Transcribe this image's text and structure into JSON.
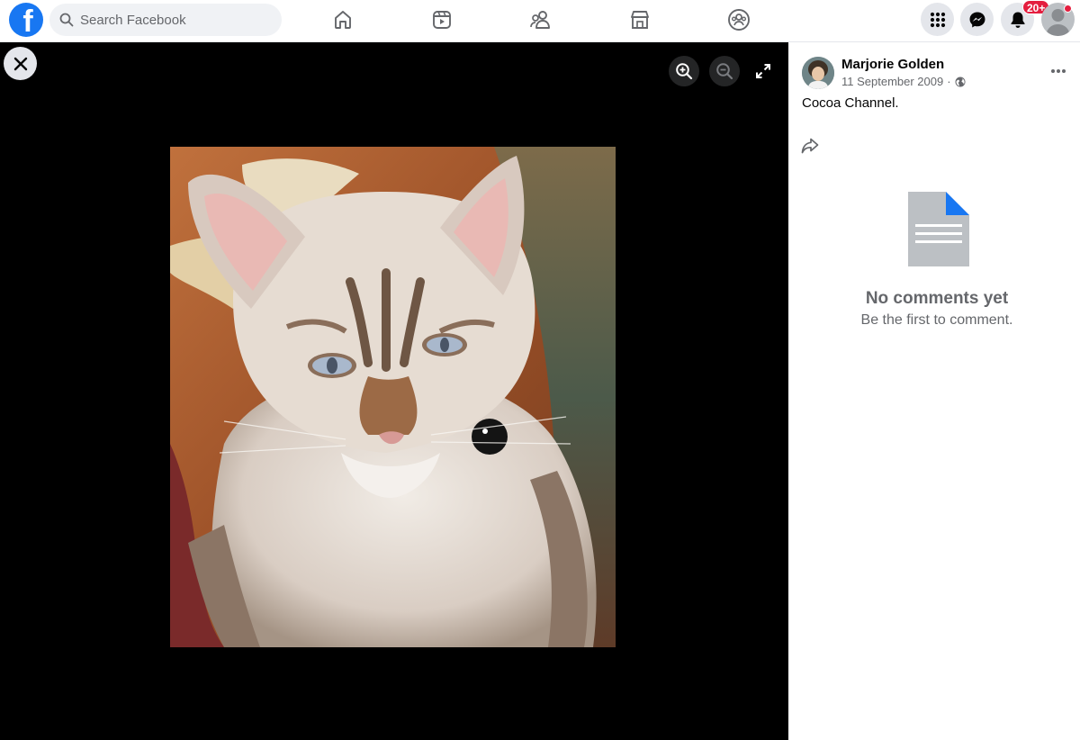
{
  "header": {
    "logo_letter": "f",
    "search": {
      "placeholder": "Search Facebook",
      "value": ""
    },
    "nav_icons": [
      "home-icon",
      "video-icon",
      "friends-icon",
      "marketplace-icon",
      "groups-icon"
    ],
    "notification_badge": "20+"
  },
  "colors": {
    "brand": "#1877f2",
    "badge": "#e41e3f",
    "viewer_bg": "#000000",
    "muted_text": "#65676b"
  },
  "viewer": {
    "controls": [
      "close-icon",
      "zoom-in-icon",
      "zoom-out-icon",
      "expand-icon"
    ],
    "photo_subject": "cat"
  },
  "post": {
    "author": "Marjorie Golden",
    "date": "11 September 2009",
    "separator": "·",
    "privacy_icon": "globe-icon",
    "caption": "Cocoa Channel."
  },
  "comments": {
    "empty_title": "No comments yet",
    "empty_subtitle": "Be the first to comment."
  }
}
